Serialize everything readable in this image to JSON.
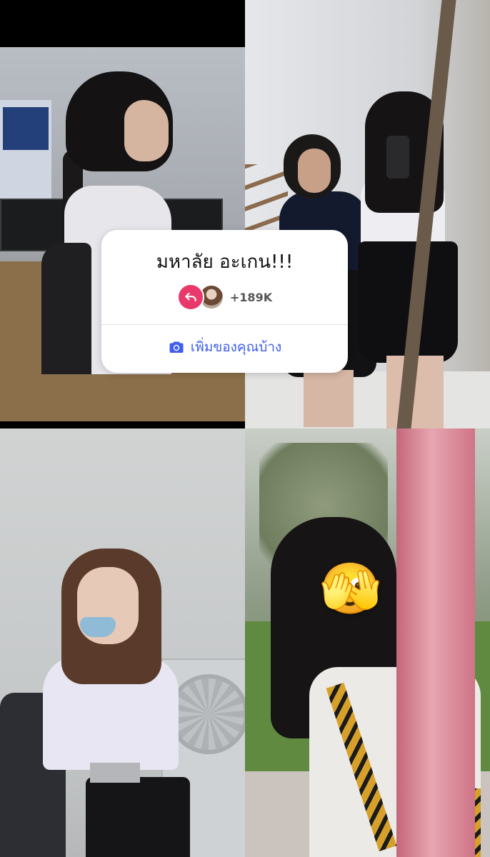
{
  "sticker": {
    "title": "มหาลัย อะเกน!!!",
    "count": "+189K",
    "action_label": "เพิ่มของคุณบ้าง",
    "accent_color": "#e8396a",
    "action_color": "#3f5ef0"
  },
  "icons": {
    "reply": "reply-arrow-icon",
    "camera": "camera-icon",
    "emoji": "🫣"
  }
}
